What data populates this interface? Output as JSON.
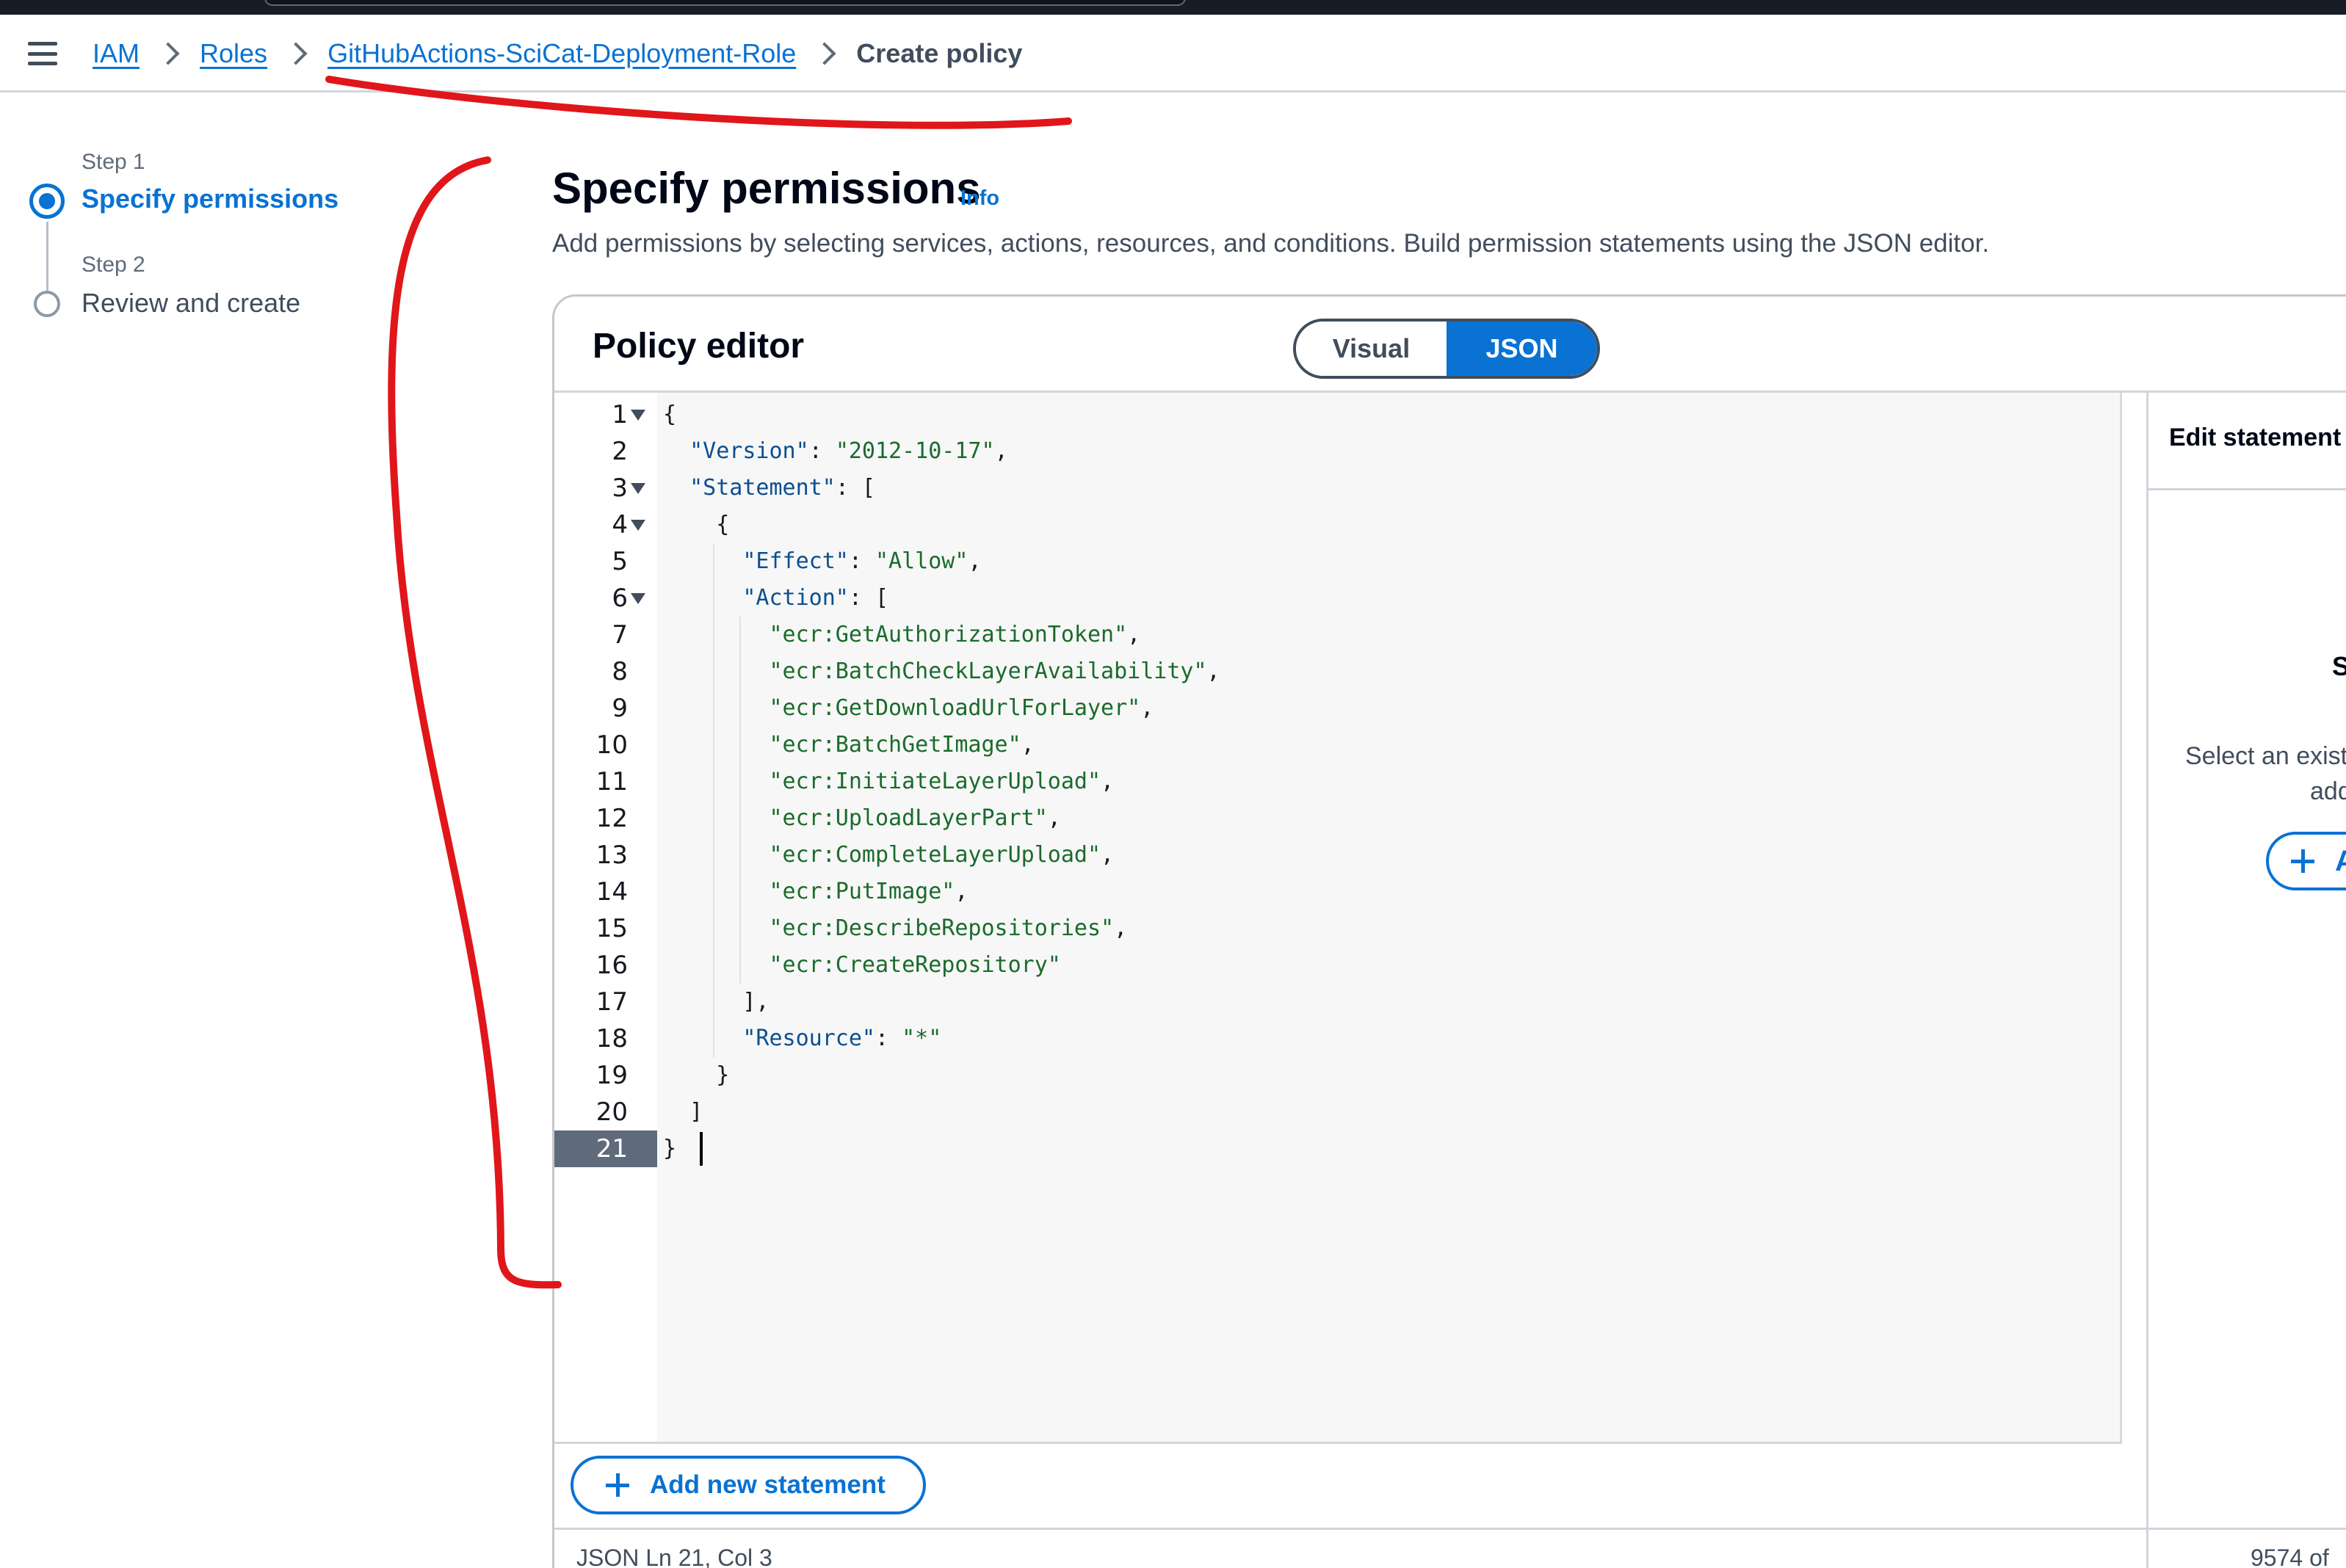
{
  "breadcrumb": {
    "items": [
      "IAM",
      "Roles",
      "GitHubActions-SciCat-Deployment-Role"
    ],
    "current": "Create policy"
  },
  "steps": [
    {
      "caption": "Step 1",
      "label": "Specify permissions",
      "state": "active"
    },
    {
      "caption": "Step 2",
      "label": "Review and create",
      "state": "pending"
    }
  ],
  "page": {
    "title": "Specify permissions",
    "info_link": "Info",
    "description": "Add permissions by selecting services, actions, resources, and conditions. Build permission statements using the JSON editor."
  },
  "editor": {
    "title": "Policy editor",
    "modes": [
      "Visual",
      "JSON"
    ],
    "selected_mode": "JSON",
    "active_line": 21,
    "lines": [
      {
        "n": "1",
        "fold": true,
        "text": "{"
      },
      {
        "n": "2",
        "fold": false,
        "text": "  \"Version\": \"2012-10-17\","
      },
      {
        "n": "3",
        "fold": true,
        "text": "  \"Statement\": ["
      },
      {
        "n": "4",
        "fold": true,
        "text": "    {"
      },
      {
        "n": "5",
        "fold": false,
        "text": "      \"Effect\": \"Allow\","
      },
      {
        "n": "6",
        "fold": true,
        "text": "      \"Action\": ["
      },
      {
        "n": "7",
        "fold": false,
        "text": "        \"ecr:GetAuthorizationToken\","
      },
      {
        "n": "8",
        "fold": false,
        "text": "        \"ecr:BatchCheckLayerAvailability\","
      },
      {
        "n": "9",
        "fold": false,
        "text": "        \"ecr:GetDownloadUrlForLayer\","
      },
      {
        "n": "10",
        "fold": false,
        "text": "        \"ecr:BatchGetImage\","
      },
      {
        "n": "11",
        "fold": false,
        "text": "        \"ecr:InitiateLayerUpload\","
      },
      {
        "n": "12",
        "fold": false,
        "text": "        \"ecr:UploadLayerPart\","
      },
      {
        "n": "13",
        "fold": false,
        "text": "        \"ecr:CompleteLayerUpload\","
      },
      {
        "n": "14",
        "fold": false,
        "text": "        \"ecr:PutImage\","
      },
      {
        "n": "15",
        "fold": false,
        "text": "        \"ecr:DescribeRepositories\","
      },
      {
        "n": "16",
        "fold": false,
        "text": "        \"ecr:CreateRepository\""
      },
      {
        "n": "17",
        "fold": false,
        "text": "      ],"
      },
      {
        "n": "18",
        "fold": false,
        "text": "      \"Resource\": \"*\""
      },
      {
        "n": "19",
        "fold": false,
        "text": "    }"
      },
      {
        "n": "20",
        "fold": false,
        "text": "  ]"
      },
      {
        "n": "21",
        "fold": false,
        "text": "}"
      }
    ],
    "add_statement_label": "Add new statement",
    "status_text": "JSON   Ln 21, Col 3",
    "char_count": "9574 of"
  },
  "side_panel": {
    "title": "Edit statement",
    "heading": "Se",
    "text_line1": "Select an exist",
    "text_line2": "add",
    "button_label": "A"
  },
  "colors": {
    "accent": "#0972d3",
    "annotation": "#e0161b",
    "topbar": "#161d26"
  }
}
